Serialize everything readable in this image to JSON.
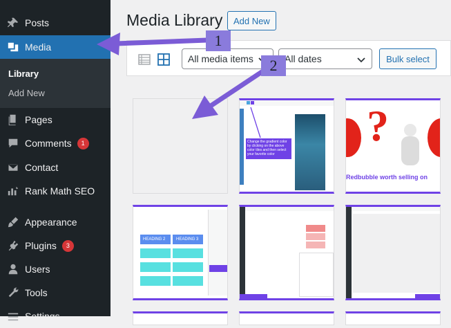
{
  "sidebar": {
    "items": [
      {
        "label": "Posts",
        "icon": "pushpin-icon"
      },
      {
        "label": "Media",
        "icon": "media-icon"
      },
      {
        "label": "Pages",
        "icon": "pages-icon"
      },
      {
        "label": "Comments",
        "icon": "comment-icon",
        "badge": "1"
      },
      {
        "label": "Contact",
        "icon": "mail-icon"
      },
      {
        "label": "Rank Math SEO",
        "icon": "chart-icon"
      },
      {
        "label": "Appearance",
        "icon": "brush-icon"
      },
      {
        "label": "Plugins",
        "icon": "plugin-icon",
        "badge": "3"
      },
      {
        "label": "Users",
        "icon": "user-icon"
      },
      {
        "label": "Tools",
        "icon": "wrench-icon"
      },
      {
        "label": "Settings",
        "icon": "settings-icon"
      }
    ],
    "media_submenu": [
      "Library",
      "Add New"
    ]
  },
  "header": {
    "title": "Media Library",
    "add_new": "Add New"
  },
  "toolbar": {
    "media_filter": "All media items",
    "date_filter": "All dates",
    "bulk_select": "Bulk select"
  },
  "thumbnails": {
    "t2_text": "Change the gradient color by clicking on the above color tiles and then select your favorite color",
    "t3_text": "Redbubble worth selling on",
    "t4_heading_a": "HEADING 2",
    "t4_heading_b": "HEADING 3"
  },
  "annotations": {
    "callout_1": "1",
    "callout_2": "2",
    "color": "#7b5cd6"
  },
  "colors": {
    "sidebar_bg": "#1d2327",
    "active": "#2271b1",
    "accent": "#6f42e6",
    "badge": "#d63638"
  }
}
